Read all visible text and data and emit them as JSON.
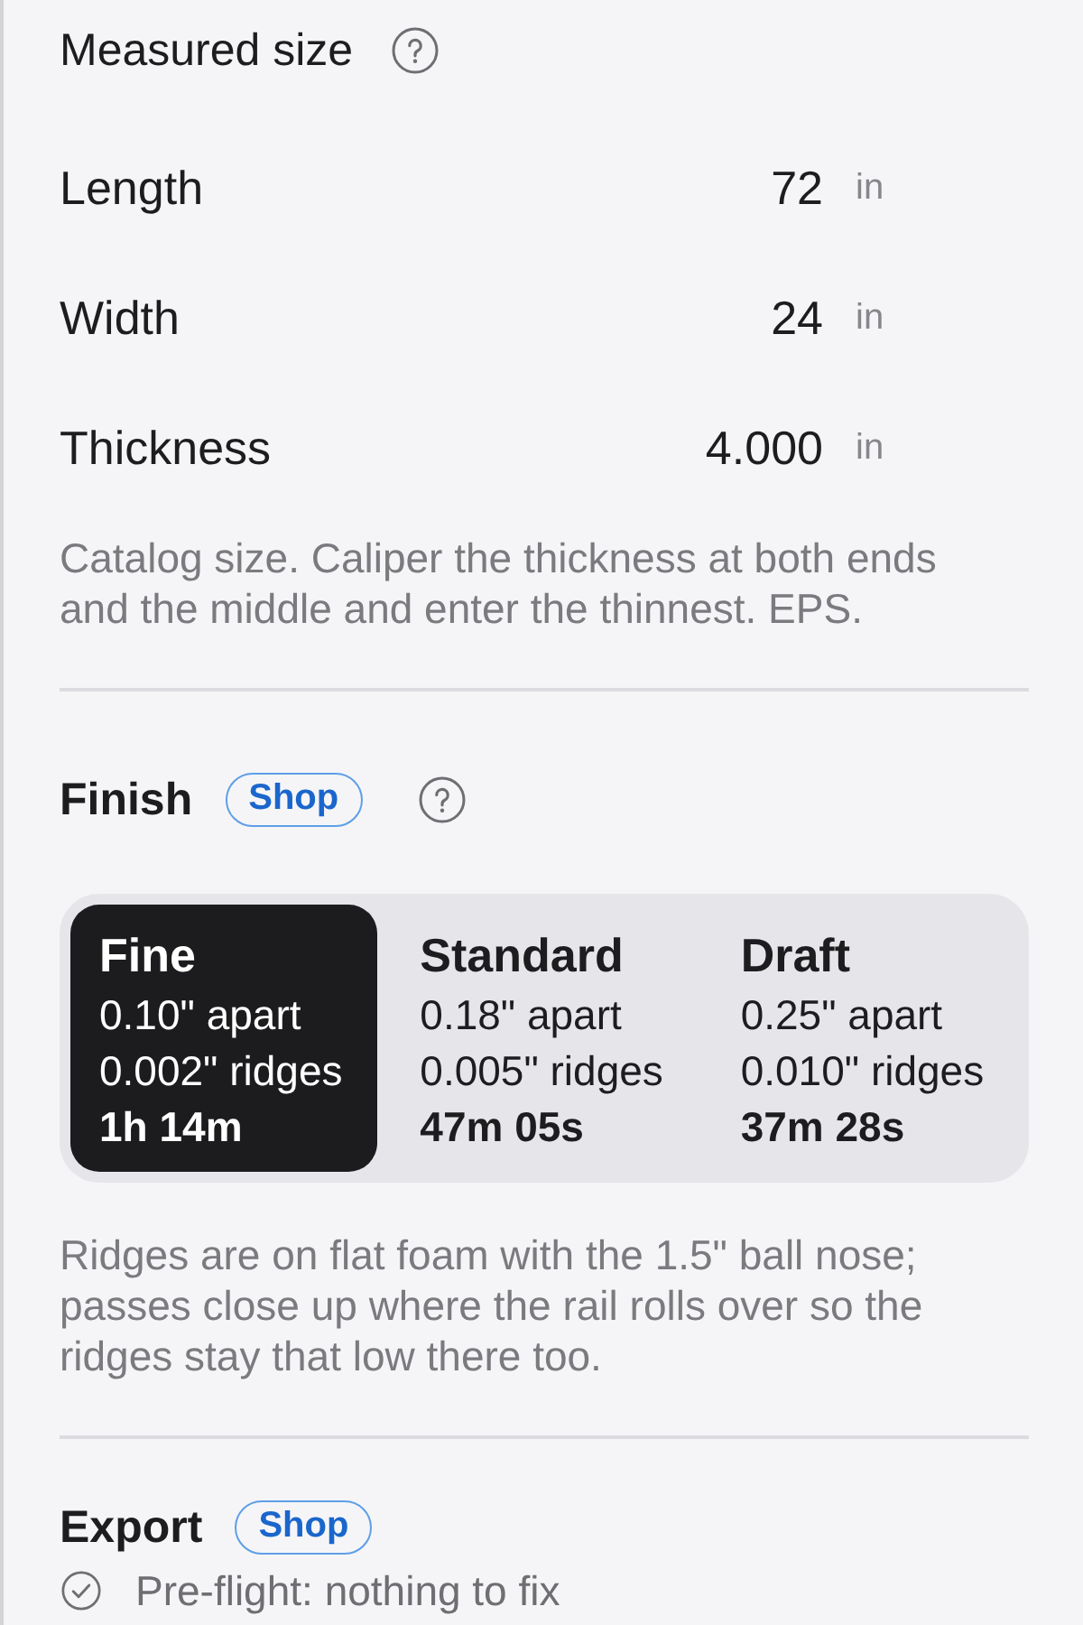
{
  "measured_size": {
    "title": "Measured size",
    "rows": [
      {
        "label": "Length",
        "value": "72",
        "unit": "in"
      },
      {
        "label": "Width",
        "value": "24",
        "unit": "in"
      },
      {
        "label": "Thickness",
        "value": "4.000",
        "unit": "in"
      }
    ],
    "note": "Catalog size. Caliper the thickness at both ends and the middle and enter the thinnest. EPS."
  },
  "finish": {
    "title": "Finish",
    "tag": "Shop",
    "options": [
      {
        "name": "Fine",
        "spacing": "0.10\" apart",
        "ridges": "0.002\" ridges",
        "time": "1h 14m",
        "selected": true
      },
      {
        "name": "Standard",
        "spacing": "0.18\" apart",
        "ridges": "0.005\" ridges",
        "time": "47m 05s",
        "selected": false
      },
      {
        "name": "Draft",
        "spacing": "0.25\" apart",
        "ridges": "0.010\" ridges",
        "time": "37m 28s",
        "selected": false
      }
    ],
    "note": "Ridges are on flat foam with the 1.5\" ball nose; passes close up where the rail rolls over so the ridges stay that low there too."
  },
  "export": {
    "title": "Export",
    "tag": "Shop",
    "preflight": "Pre-flight: nothing to fix"
  }
}
